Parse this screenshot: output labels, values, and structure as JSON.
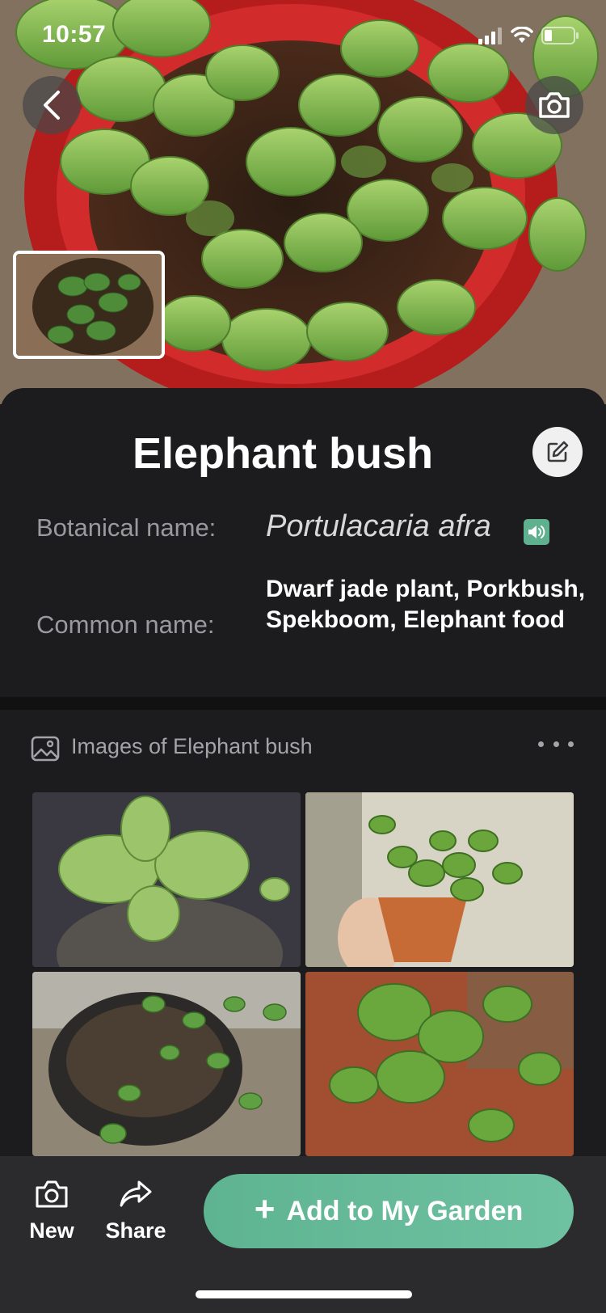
{
  "status_bar": {
    "time": "10:57",
    "icons": [
      "signal-icon",
      "wifi-icon",
      "battery-icon"
    ]
  },
  "header": {
    "back_icon": "chevron-left-icon",
    "camera_icon": "camera-icon"
  },
  "plant": {
    "title": "Elephant bush",
    "botanical_label": "Botanical name:",
    "botanical_name": "Portulacaria afra",
    "common_label": "Common name:",
    "common_name": "Dwarf jade plant, Porkbush, Spekboom, Elephant food",
    "edit_icon": "edit-icon",
    "audio_icon": "speaker-icon"
  },
  "images": {
    "title": "Images of Elephant bush",
    "header_icon": "image-icon",
    "more_icon": "more-horizontal-icon",
    "count": 4
  },
  "bottom_bar": {
    "new_label": "New",
    "share_label": "Share",
    "add_label": "Add to My Garden",
    "add_prefix": "+"
  },
  "colors": {
    "accent": "#5fb08f",
    "background": "#1c1c1e",
    "bottom_bar": "#2b2b2d",
    "muted_text": "#9a9a9e"
  }
}
